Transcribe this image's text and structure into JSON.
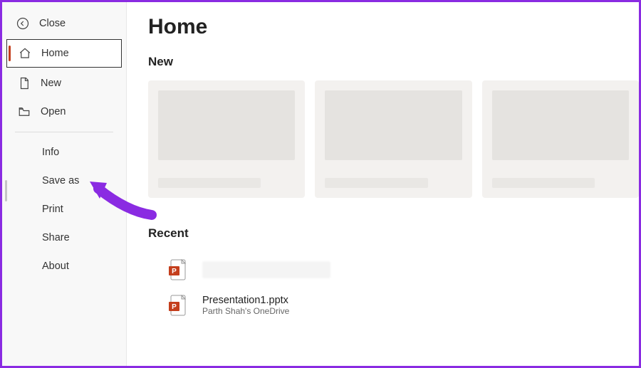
{
  "sidebar": {
    "close": "Close",
    "home": "Home",
    "new": "New",
    "open": "Open",
    "sub": {
      "info": "Info",
      "saveas": "Save as",
      "print": "Print",
      "share": "Share",
      "about": "About"
    }
  },
  "main": {
    "title": "Home",
    "new_section": "New",
    "recent_section": "Recent",
    "recent": [
      {
        "name": "",
        "sub": ""
      },
      {
        "name": "Presentation1.pptx",
        "sub": "Parth Shah's OneDrive"
      }
    ]
  }
}
